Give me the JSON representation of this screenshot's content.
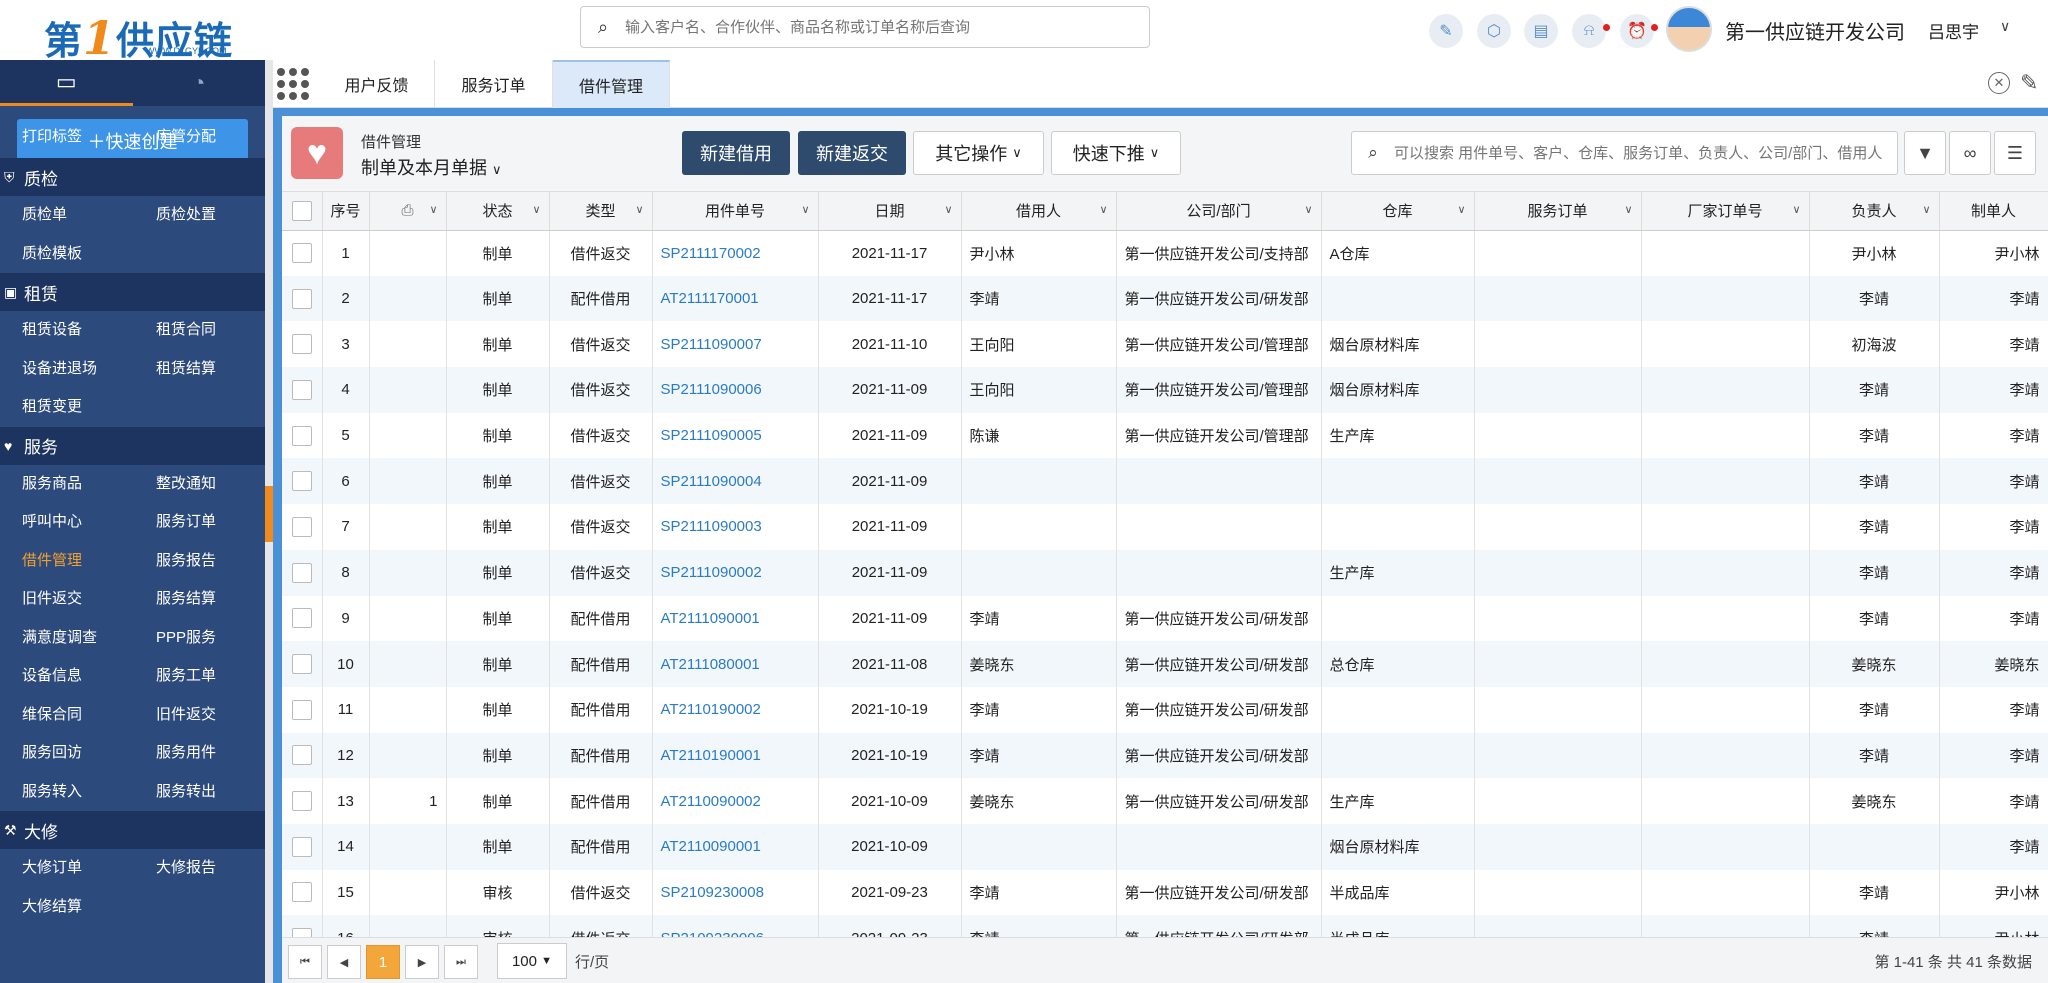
{
  "logo": {
    "text_main": "第",
    "text_num": "1",
    "text_rest": "供应链",
    "url": "WWW.D1GYL.COM"
  },
  "search": {
    "placeholder": "输入客户名、合作伙伴、商品名称或订单名称后查询"
  },
  "header": {
    "company": "第一供应链开发公司",
    "user": "吕思宇",
    "icons": [
      "edit-icon",
      "cube-icon",
      "book-icon",
      "bell-icon",
      "alarm-icon"
    ]
  },
  "sidebar": {
    "quick_create": "＋快速创建",
    "partial_items": [
      "打印标签",
      "库管分配"
    ],
    "groups": [
      {
        "title": "质检",
        "icon": "shield-icon",
        "items": [
          "质检单",
          "质检处置",
          "质检模板"
        ]
      },
      {
        "title": "租赁",
        "icon": "lease-icon",
        "items": [
          "租赁设备",
          "租赁合同",
          "设备进退场",
          "租赁结算",
          "租赁变更"
        ]
      },
      {
        "title": "服务",
        "icon": "heart-icon",
        "items": [
          "服务商品",
          "整改通知",
          "呼叫中心",
          "服务订单",
          "借件管理",
          "服务报告",
          "旧件返交",
          "服务结算",
          "满意度调查",
          "PPP服务",
          "设备信息",
          "服务工单",
          "维保合同",
          "旧件返交",
          "服务回访",
          "服务用件",
          "服务转入",
          "服务转出"
        ]
      },
      {
        "title": "大修",
        "icon": "tools-icon",
        "items": [
          "大修订单",
          "大修报告",
          "大修结算"
        ]
      }
    ],
    "active_item": "借件管理"
  },
  "tabs": [
    {
      "label": "用户反馈",
      "active": false
    },
    {
      "label": "服务订单",
      "active": false
    },
    {
      "label": "借件管理",
      "active": true
    }
  ],
  "toolbar": {
    "module_title": "借件管理",
    "filter": "制单及本月单据",
    "new_borrow": "新建借用",
    "new_return": "新建返交",
    "other_ops": "其它操作",
    "quick_push": "快速下推",
    "search_placeholder": "可以搜索 用件单号、客户、仓库、服务订单、负责人、公司/部门、借用人"
  },
  "table": {
    "columns": [
      "序号",
      "",
      "状态",
      "类型",
      "用件单号",
      "日期",
      "借用人",
      "公司/部门",
      "仓库",
      "服务订单",
      "厂家订单号",
      "负责人",
      "制单人"
    ],
    "rows": [
      [
        "1",
        "",
        "制单",
        "借件返交",
        "SP2111170002",
        "2021-11-17",
        "尹小林",
        "第一供应链开发公司/支持部",
        "A仓库",
        "",
        "",
        "尹小林",
        "尹小林"
      ],
      [
        "2",
        "",
        "制单",
        "配件借用",
        "AT2111170001",
        "2021-11-17",
        "李靖",
        "第一供应链开发公司/研发部",
        "",
        "",
        "",
        "李靖",
        "李靖"
      ],
      [
        "3",
        "",
        "制单",
        "借件返交",
        "SP2111090007",
        "2021-11-10",
        "王向阳",
        "第一供应链开发公司/管理部",
        "烟台原材料库",
        "",
        "",
        "初海波",
        "李靖"
      ],
      [
        "4",
        "",
        "制单",
        "借件返交",
        "SP2111090006",
        "2021-11-09",
        "王向阳",
        "第一供应链开发公司/管理部",
        "烟台原材料库",
        "",
        "",
        "李靖",
        "李靖"
      ],
      [
        "5",
        "",
        "制单",
        "借件返交",
        "SP2111090005",
        "2021-11-09",
        "陈谦",
        "第一供应链开发公司/管理部",
        "生产库",
        "",
        "",
        "李靖",
        "李靖"
      ],
      [
        "6",
        "",
        "制单",
        "借件返交",
        "SP2111090004",
        "2021-11-09",
        "",
        "",
        "",
        "",
        "",
        "李靖",
        "李靖"
      ],
      [
        "7",
        "",
        "制单",
        "借件返交",
        "SP2111090003",
        "2021-11-09",
        "",
        "",
        "",
        "",
        "",
        "李靖",
        "李靖"
      ],
      [
        "8",
        "",
        "制单",
        "借件返交",
        "SP2111090002",
        "2021-11-09",
        "",
        "",
        "生产库",
        "",
        "",
        "李靖",
        "李靖"
      ],
      [
        "9",
        "",
        "制单",
        "配件借用",
        "AT2111090001",
        "2021-11-09",
        "李靖",
        "第一供应链开发公司/研发部",
        "",
        "",
        "",
        "李靖",
        "李靖"
      ],
      [
        "10",
        "",
        "制单",
        "配件借用",
        "AT2111080001",
        "2021-11-08",
        "姜晓东",
        "第一供应链开发公司/研发部",
        "总仓库",
        "",
        "",
        "姜晓东",
        "姜晓东"
      ],
      [
        "11",
        "",
        "制单",
        "配件借用",
        "AT2110190002",
        "2021-10-19",
        "李靖",
        "第一供应链开发公司/研发部",
        "",
        "",
        "",
        "李靖",
        "李靖"
      ],
      [
        "12",
        "",
        "制单",
        "配件借用",
        "AT2110190001",
        "2021-10-19",
        "李靖",
        "第一供应链开发公司/研发部",
        "",
        "",
        "",
        "李靖",
        "李靖"
      ],
      [
        "13",
        "1",
        "制单",
        "配件借用",
        "AT2110090002",
        "2021-10-09",
        "姜晓东",
        "第一供应链开发公司/研发部",
        "生产库",
        "",
        "",
        "姜晓东",
        "李靖"
      ],
      [
        "14",
        "",
        "制单",
        "配件借用",
        "AT2110090001",
        "2021-10-09",
        "",
        "",
        "烟台原材料库",
        "",
        "",
        "",
        "李靖"
      ],
      [
        "15",
        "",
        "审核",
        "借件返交",
        "SP2109230008",
        "2021-09-23",
        "李靖",
        "第一供应链开发公司/研发部",
        "半成品库",
        "",
        "",
        "李靖",
        "尹小林"
      ],
      [
        "16",
        "",
        "审核",
        "借件返交",
        "SP2109230006",
        "2021-09-23",
        "李靖",
        "第一供应链开发公司/研发部",
        "半成品库",
        "",
        "",
        "李靖",
        "尹小林"
      ]
    ]
  },
  "pager": {
    "current": "1",
    "page_size": "100",
    "per_page_label": "行/页",
    "summary": "第 1-41 条 共 41 条数据"
  }
}
